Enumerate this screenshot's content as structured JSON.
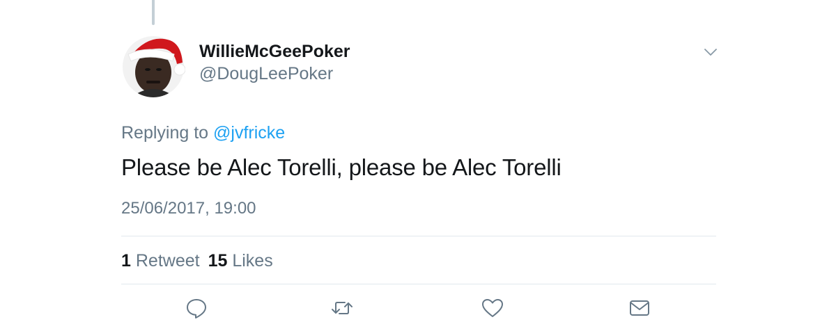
{
  "tweet": {
    "display_name": "WillieMcGeePoker",
    "handle": "@DougLeePoker",
    "replying_prefix": "Replying to",
    "replying_to": "@jvfricke",
    "text": "Please be Alec Torelli, please be Alec Torelli",
    "timestamp": "25/06/2017, 19:00"
  },
  "stats": {
    "retweets_count": "1",
    "retweets_label": "Retweet",
    "likes_count": "15",
    "likes_label": "Likes"
  },
  "icons": {
    "more": "chevron-down-icon",
    "reply": "reply-icon",
    "retweet": "retweet-icon",
    "like": "heart-icon",
    "message": "envelope-icon"
  },
  "colors": {
    "text_primary": "#14171a",
    "text_secondary": "#657786",
    "link": "#1da1f2",
    "divider": "#e1e8ed"
  }
}
